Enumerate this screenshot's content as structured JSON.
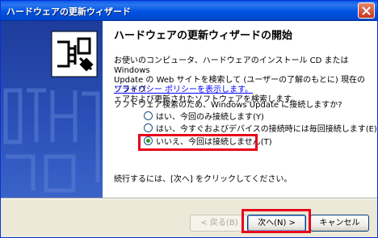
{
  "window": {
    "title": "ハードウェアの更新ウィザード"
  },
  "main": {
    "heading": "ハードウェアの更新ウィザードの開始",
    "paragraph_lines": [
      "お使いのコンピュータ、ハードウェアのインストール CD または Windows",
      "Update の Web サイトを検索して (ユーザーの了解のもとに) 現在のソフトウ",
      "ェアおよび更新されたソフトウェアを検索します。"
    ],
    "privacy_link": "プライバシー ポリシーを表示します。",
    "question": "ソフトウェア検索のため、Windows Update に接続しますか?",
    "options": [
      {
        "label": "はい、今回のみ接続します(Y)",
        "selected": false
      },
      {
        "label": "はい、今すぐおよびデバイスの接続時には毎回接続します(E)",
        "selected": false
      },
      {
        "label": "いいえ、今回は接続しません(T)",
        "selected": true
      }
    ],
    "continue_text": "続行するには、[次へ] をクリックしてください。"
  },
  "buttons": {
    "back": "< 戻る(B)",
    "next": "次へ(N) >",
    "cancel": "キャンセル"
  },
  "colors": {
    "highlight": "#E8001C",
    "titlebar": "#0054E3",
    "sidepanel": "#2A4FB6"
  }
}
